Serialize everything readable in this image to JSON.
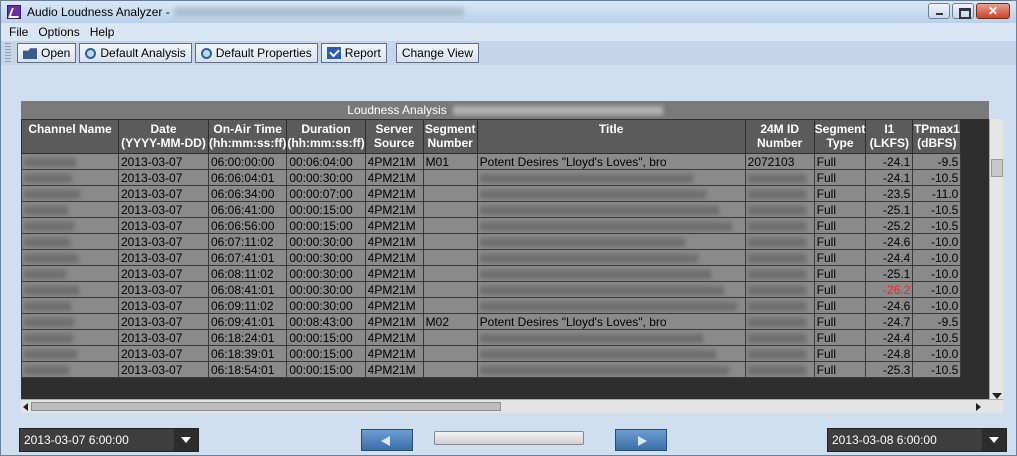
{
  "window": {
    "title": "Audio Loudness Analyzer -",
    "controls": [
      "minimize-icon",
      "maximize-icon",
      "close-icon"
    ]
  },
  "menu": [
    "File",
    "Options",
    "Help"
  ],
  "toolbar": {
    "open": "Open",
    "default_analysis": "Default Analysis",
    "default_properties": "Default Properties",
    "report": "Report",
    "change_view": "Change View"
  },
  "section_title": "Loudness Analysis",
  "columns": [
    [
      "Channel Name",
      ""
    ],
    [
      "Date",
      "(YYYY-MM-DD)"
    ],
    [
      "On-Air Time",
      "(hh:mm:ss:ff)"
    ],
    [
      "Duration",
      "(hh:mm:ss:ff)"
    ],
    [
      "Server",
      "Source"
    ],
    [
      "Segment",
      "Number"
    ],
    [
      "Title",
      ""
    ],
    [
      "24M ID",
      "Number"
    ],
    [
      "Segment",
      "Type"
    ],
    [
      "I1",
      "(LKFS)"
    ],
    [
      "TPmax1",
      "(dBFS)"
    ]
  ],
  "rows": [
    {
      "date": "2013-03-07",
      "time": "06:00:00:00",
      "duration": "00:06:04:00",
      "source": "4PM21M",
      "segment": "M01",
      "title": "Potent Desires \"Lloyd's Loves\", bro",
      "id": "2072103",
      "type": "Full",
      "i1": "-24.1",
      "tp": "-9.5",
      "red": false
    },
    {
      "date": "2013-03-07",
      "time": "06:06:04:01",
      "duration": "00:00:30:00",
      "source": "4PM21M",
      "segment": "",
      "title": "",
      "id": "",
      "type": "Full",
      "i1": "-24.1",
      "tp": "-10.5",
      "red": false
    },
    {
      "date": "2013-03-07",
      "time": "06:06:34:00",
      "duration": "00:00:07:00",
      "source": "4PM21M",
      "segment": "",
      "title": "",
      "id": "",
      "type": "Full",
      "i1": "-23.5",
      "tp": "-11.0",
      "red": false
    },
    {
      "date": "2013-03-07",
      "time": "06:06:41:00",
      "duration": "00:00:15:00",
      "source": "4PM21M",
      "segment": "",
      "title": "",
      "id": "",
      "type": "Full",
      "i1": "-25.1",
      "tp": "-10.5",
      "red": false
    },
    {
      "date": "2013-03-07",
      "time": "06:06:56:00",
      "duration": "00:00:15:00",
      "source": "4PM21M",
      "segment": "",
      "title": "",
      "id": "",
      "type": "Full",
      "i1": "-25.2",
      "tp": "-10.5",
      "red": false
    },
    {
      "date": "2013-03-07",
      "time": "06:07:11:02",
      "duration": "00:00:30:00",
      "source": "4PM21M",
      "segment": "",
      "title": "",
      "id": "",
      "type": "Full",
      "i1": "-24.6",
      "tp": "-10.0",
      "red": false
    },
    {
      "date": "2013-03-07",
      "time": "06:07:41:01",
      "duration": "00:00:30:00",
      "source": "4PM21M",
      "segment": "",
      "title": "",
      "id": "",
      "type": "Full",
      "i1": "-24.4",
      "tp": "-10.0",
      "red": false
    },
    {
      "date": "2013-03-07",
      "time": "06:08:11:02",
      "duration": "00:00:30:00",
      "source": "4PM21M",
      "segment": "",
      "title": "",
      "id": "",
      "type": "Full",
      "i1": "-25.1",
      "tp": "-10.0",
      "red": false
    },
    {
      "date": "2013-03-07",
      "time": "06:08:41:01",
      "duration": "00:00:30:00",
      "source": "4PM21M",
      "segment": "",
      "title": "",
      "id": "",
      "type": "Full",
      "i1": "-26.2",
      "tp": "-10.0",
      "red": true
    },
    {
      "date": "2013-03-07",
      "time": "06:09:11:02",
      "duration": "00:00:30:00",
      "source": "4PM21M",
      "segment": "",
      "title": "",
      "id": "",
      "type": "Full",
      "i1": "-24.6",
      "tp": "-10.0",
      "red": false
    },
    {
      "date": "2013-03-07",
      "time": "06:09:41:01",
      "duration": "00:08:43:00",
      "source": "4PM21M",
      "segment": "M02",
      "title": "Potent Desires \"Lloyd's Loves\", bro",
      "id": "",
      "type": "Full",
      "i1": "-24.7",
      "tp": "-9.5",
      "red": false
    },
    {
      "date": "2013-03-07",
      "time": "06:18:24:01",
      "duration": "00:00:15:00",
      "source": "4PM21M",
      "segment": "",
      "title": "",
      "id": "",
      "type": "Full",
      "i1": "-24.4",
      "tp": "-10.5",
      "red": false
    },
    {
      "date": "2013-03-07",
      "time": "06:18:39:01",
      "duration": "00:00:15:00",
      "source": "4PM21M",
      "segment": "",
      "title": "",
      "id": "",
      "type": "Full",
      "i1": "-24.8",
      "tp": "-10.0",
      "red": false
    },
    {
      "date": "2013-03-07",
      "time": "06:18:54:01",
      "duration": "00:00:15:00",
      "source": "4PM21M",
      "segment": "",
      "title": "",
      "id": "",
      "type": "Full",
      "i1": "-25.3",
      "tp": "-10.5",
      "red": false
    }
  ],
  "footer": {
    "start": "2013-03-07 6:00:00",
    "end": "2013-03-08 6:00:00"
  }
}
